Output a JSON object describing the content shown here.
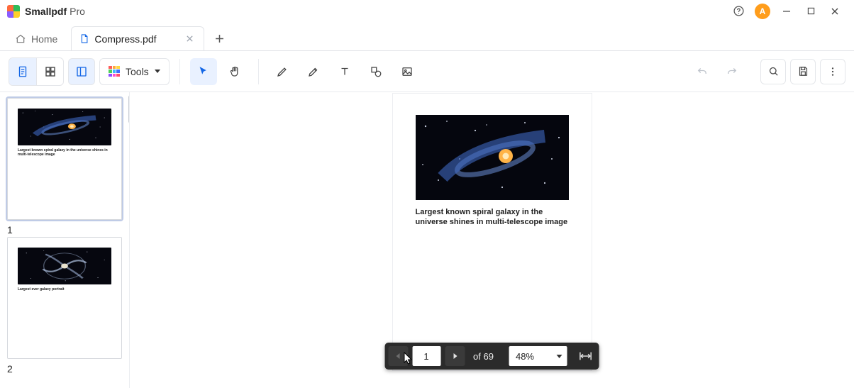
{
  "app": {
    "name": "Smallpdf",
    "edition": "Pro"
  },
  "window": {
    "avatar_initial": "A"
  },
  "tabs": {
    "home_label": "Home",
    "items": [
      {
        "label": "Compress.pdf",
        "active": true
      }
    ]
  },
  "toolbar": {
    "tools_label": "Tools"
  },
  "sidebar": {
    "thumbs": [
      {
        "number": "1",
        "caption": "Largest known spiral galaxy in the universe shines in multi-telescope image"
      },
      {
        "number": "2",
        "caption": "Largest ever galaxy portrait"
      }
    ]
  },
  "document": {
    "caption": "Largest known spiral galaxy in the universe shines in multi-telescope image"
  },
  "pager": {
    "current": "1",
    "of_label": "of 69",
    "zoom": "48%"
  }
}
